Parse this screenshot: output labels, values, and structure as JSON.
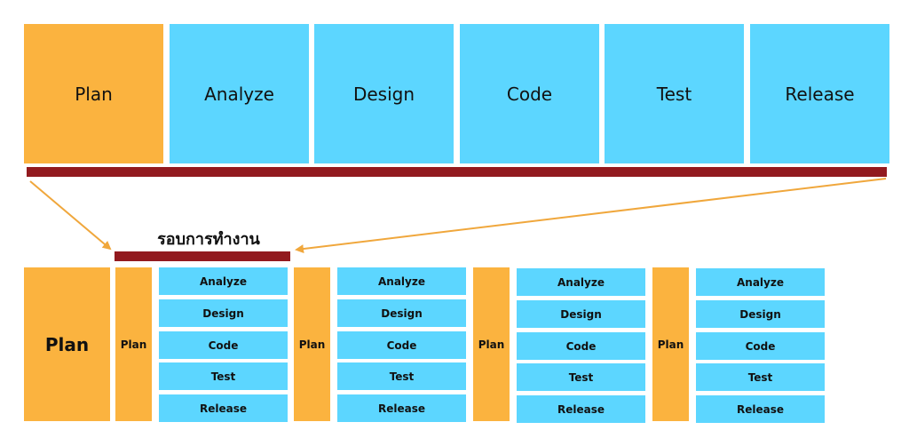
{
  "colors": {
    "plan": "#FBB33F",
    "phase": "#5CD6FF",
    "bar": "#921A1F",
    "arrow": "#F0A73C"
  },
  "top_row": {
    "phases": [
      "Plan",
      "Analyze",
      "Design",
      "Code",
      "Test",
      "Release"
    ]
  },
  "cycle_label": "รอบการทำงาน",
  "bottom": {
    "main_plan": "Plan",
    "iterations": [
      {
        "plan": "Plan",
        "steps": [
          "Analyze",
          "Design",
          "Code",
          "Test",
          "Release"
        ]
      },
      {
        "plan": "Plan",
        "steps": [
          "Analyze",
          "Design",
          "Code",
          "Test",
          "Release"
        ]
      },
      {
        "plan": "Plan",
        "steps": [
          "Analyze",
          "Design",
          "Code",
          "Test",
          "Release"
        ]
      },
      {
        "plan": "Plan",
        "steps": [
          "Analyze",
          "Design",
          "Code",
          "Test",
          "Release"
        ]
      }
    ]
  }
}
